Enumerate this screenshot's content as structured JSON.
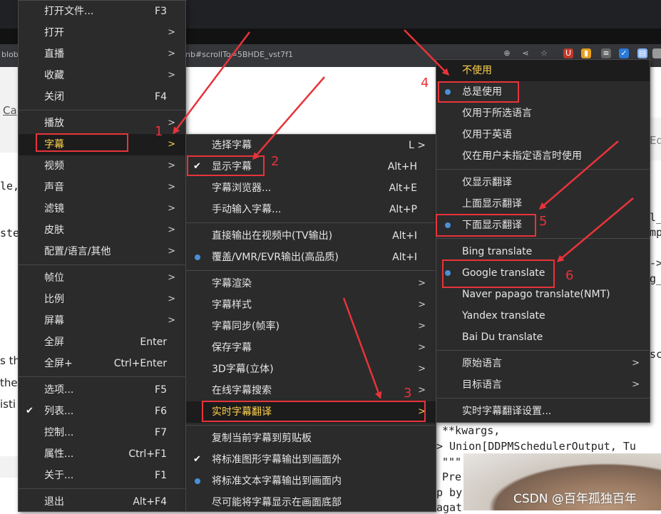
{
  "browser": {
    "url_fragment_left": "blob,",
    "url_fragment_right": "nb#scrollTo=5BHDE_vst7f1"
  },
  "background_text": {
    "ca_link": "Ca",
    "le": "le,",
    "ste": "ste",
    "s_th": "s th",
    "the": "the",
    "istin": "isti",
    "ed": "Ed",
    "l_under": "l_",
    "mp": "mp",
    "arrow_dash": "->",
    "g_under": "g_",
    "sc": "sc",
    "kwargs": "**kwargs,",
    "union_line": "> Union[DDPMSchedulerOutput, Tu",
    "triple_quote": "\"\"\"",
    "pre": "Pre",
    "p_by": "p by",
    "agat": "agat"
  },
  "watermark": "CSDN @百年孤独百年",
  "main_menu": {
    "items": [
      {
        "label": "打开文件...",
        "shortcut": "F3"
      },
      {
        "label": "打开",
        "arrow": ">"
      },
      {
        "label": "直播",
        "arrow": ">"
      },
      {
        "label": "收藏",
        "arrow": ">"
      },
      {
        "label": "关闭",
        "shortcut": "F4"
      },
      {
        "label": "播放",
        "arrow": ">"
      },
      {
        "label": "字幕",
        "arrow": ">"
      },
      {
        "label": "视频",
        "arrow": ">"
      },
      {
        "label": "声音",
        "arrow": ">"
      },
      {
        "label": "滤镜",
        "arrow": ">"
      },
      {
        "label": "皮肤",
        "arrow": ">"
      },
      {
        "label": "配置/语言/其他",
        "arrow": ">"
      },
      {
        "label": "帧位",
        "arrow": ">"
      },
      {
        "label": "比例",
        "arrow": ">"
      },
      {
        "label": "屏幕",
        "arrow": ">"
      },
      {
        "label": "全屏",
        "shortcut": "Enter"
      },
      {
        "label": "全屏+",
        "shortcut": "Ctrl+Enter"
      },
      {
        "label": "选项...",
        "shortcut": "F5"
      },
      {
        "label": "列表...",
        "shortcut": "F6",
        "check": "✔"
      },
      {
        "label": "控制...",
        "shortcut": "F7"
      },
      {
        "label": "属性...",
        "shortcut": "Ctrl+F1"
      },
      {
        "label": "关于...",
        "shortcut": "F1"
      },
      {
        "label": "退出",
        "shortcut": "Alt+F4"
      }
    ]
  },
  "subtitle_menu": {
    "items": [
      {
        "label": "选择字幕",
        "shortcut": "L >"
      },
      {
        "label": "显示字幕",
        "shortcut": "Alt+H",
        "check": "✔"
      },
      {
        "label": "字幕浏览器...",
        "shortcut": "Alt+E"
      },
      {
        "label": "手动输入字幕...",
        "shortcut": "Alt+P"
      },
      {
        "label": "直接输出在视频中(TV输出)",
        "shortcut": "Alt+I"
      },
      {
        "label": "覆盖/VMR/EVR输出(高品质)",
        "shortcut": "Alt+I"
      },
      {
        "label": "字幕渲染",
        "arrow": ">"
      },
      {
        "label": "字幕样式",
        "arrow": ">"
      },
      {
        "label": "字幕同步(帧率)",
        "arrow": ">"
      },
      {
        "label": "保存字幕",
        "arrow": ">"
      },
      {
        "label": "3D字幕(立体)",
        "arrow": ">"
      },
      {
        "label": "在线字幕搜索",
        "arrow": ">"
      },
      {
        "label": "实时字幕翻译",
        "arrow": ">"
      },
      {
        "label": "复制当前字幕到剪贴板"
      },
      {
        "label": "将标准图形字幕输出到画面外",
        "check": "✔"
      },
      {
        "label": "将标准文本字幕输出到画面内"
      },
      {
        "label": "尽可能将字幕显示在画面底部"
      }
    ]
  },
  "translate_menu": {
    "items": [
      {
        "label": "不使用"
      },
      {
        "label": "总是使用"
      },
      {
        "label": "仅用于所选语言"
      },
      {
        "label": "仅用于英语"
      },
      {
        "label": "仅在用户未指定语言时使用"
      },
      {
        "label": "仅显示翻译"
      },
      {
        "label": "上面显示翻译"
      },
      {
        "label": "下面显示翻译"
      },
      {
        "label": "Bing translate"
      },
      {
        "label": "Google translate"
      },
      {
        "label": "Naver papago translate(NMT)"
      },
      {
        "label": "Yandex translate"
      },
      {
        "label": "Bai Du translate"
      },
      {
        "label": "原始语言",
        "arrow": ">"
      },
      {
        "label": "目标语言",
        "arrow": ">"
      },
      {
        "label": "实时字幕翻译设置..."
      }
    ]
  },
  "annotations": {
    "step1": "1",
    "step2": "2",
    "step3": "3",
    "step4": "4",
    "step5": "5",
    "step6": "6"
  },
  "colors": {
    "menu_bg": "#2b2b2b",
    "highlight_text": "#ffd24d",
    "annotation_red": "#e8333a",
    "radio_blue": "#4a90d9"
  }
}
